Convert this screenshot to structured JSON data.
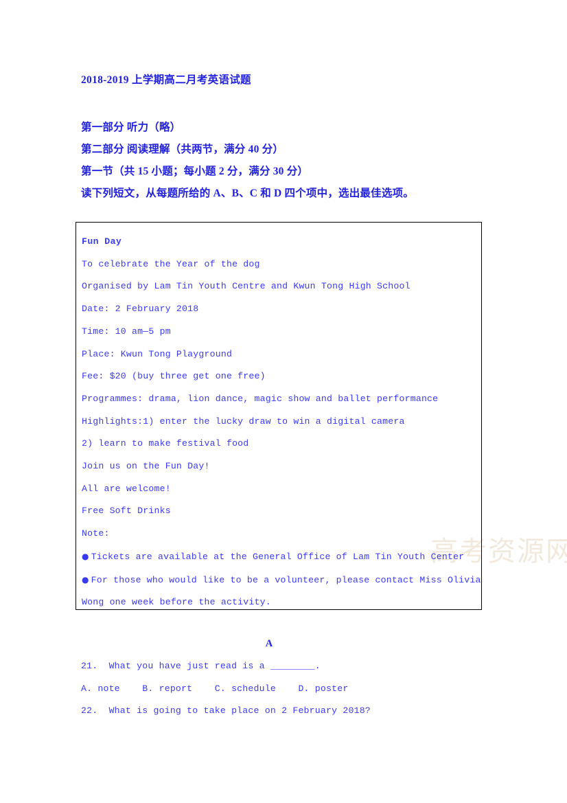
{
  "document": {
    "title": "2018-2019 上学期高二月考英语试题",
    "watermark": "高考资源网"
  },
  "sections": {
    "part_one": "第一部分 听力（略）",
    "part_two": "第二部分 阅读理解（共两节，满分 40 分）",
    "section_one": "第一节（共 15 小题；每小题 2 分，满分 30 分）",
    "instruction": "读下列短文，从每题所给的 A、B、C 和 D 四个项中，选出最佳选项。"
  },
  "poster": {
    "heading": "Fun Day",
    "lines": [
      "To celebrate the Year of the dog",
      "Organised by Lam Tin Youth Centre and Kwun Tong High School",
      "Date: 2 February 2018",
      "Time: 10 am—5 pm",
      "Place: Kwun Tong Playground",
      "Fee: $20 (buy three get one free)",
      "Programmes: drama, lion dance, magic show and ballet performance",
      "Highlights:1)  enter the lucky draw to win a digital camera",
      "2)   learn to make festival food",
      "Join us on the Fun Day!",
      "All are welcome!",
      "Free Soft Drinks",
      "Note:"
    ],
    "bullets": [
      "Tickets are available at the General Office of Lam Tin Youth Center",
      "For those who would like to be a volunteer, please contact Miss Olivia Wong one week before the activity."
    ],
    "bullet_glyph": "●"
  },
  "reading": {
    "passage_letter": "A",
    "questions": [
      {
        "number": "21.",
        "text": "21.  What you have just read is a ________.",
        "options_line": "A. note    B. report    C. schedule    D. poster"
      },
      {
        "number": "22.",
        "text": "22.  What is going to take place on 2 February 2018?"
      }
    ]
  },
  "colors": {
    "text_blue": "#3a3aef",
    "heading_blue": "#2222dd",
    "border": "#000000",
    "watermark": "#f2e9dd"
  }
}
